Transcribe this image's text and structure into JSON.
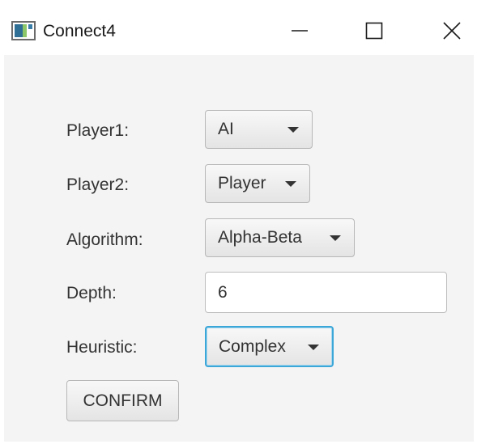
{
  "window": {
    "title": "Connect4",
    "icon": "app-window-icon",
    "controls": [
      "minimize-icon",
      "maximize-icon",
      "close-icon"
    ]
  },
  "form": {
    "player1": {
      "label": "Player1:",
      "value": "AI"
    },
    "player2": {
      "label": "Player2:",
      "value": "Player"
    },
    "algorithm": {
      "label": "Algorithm:",
      "value": "Alpha-Beta"
    },
    "depth": {
      "label": "Depth:",
      "value": "6"
    },
    "heuristic": {
      "label": "Heuristic:",
      "value": "Complex"
    },
    "confirm_label": "CONFIRM"
  },
  "colors": {
    "focus_border": "#3ba6d8",
    "client_background": "#f4f4f4"
  }
}
